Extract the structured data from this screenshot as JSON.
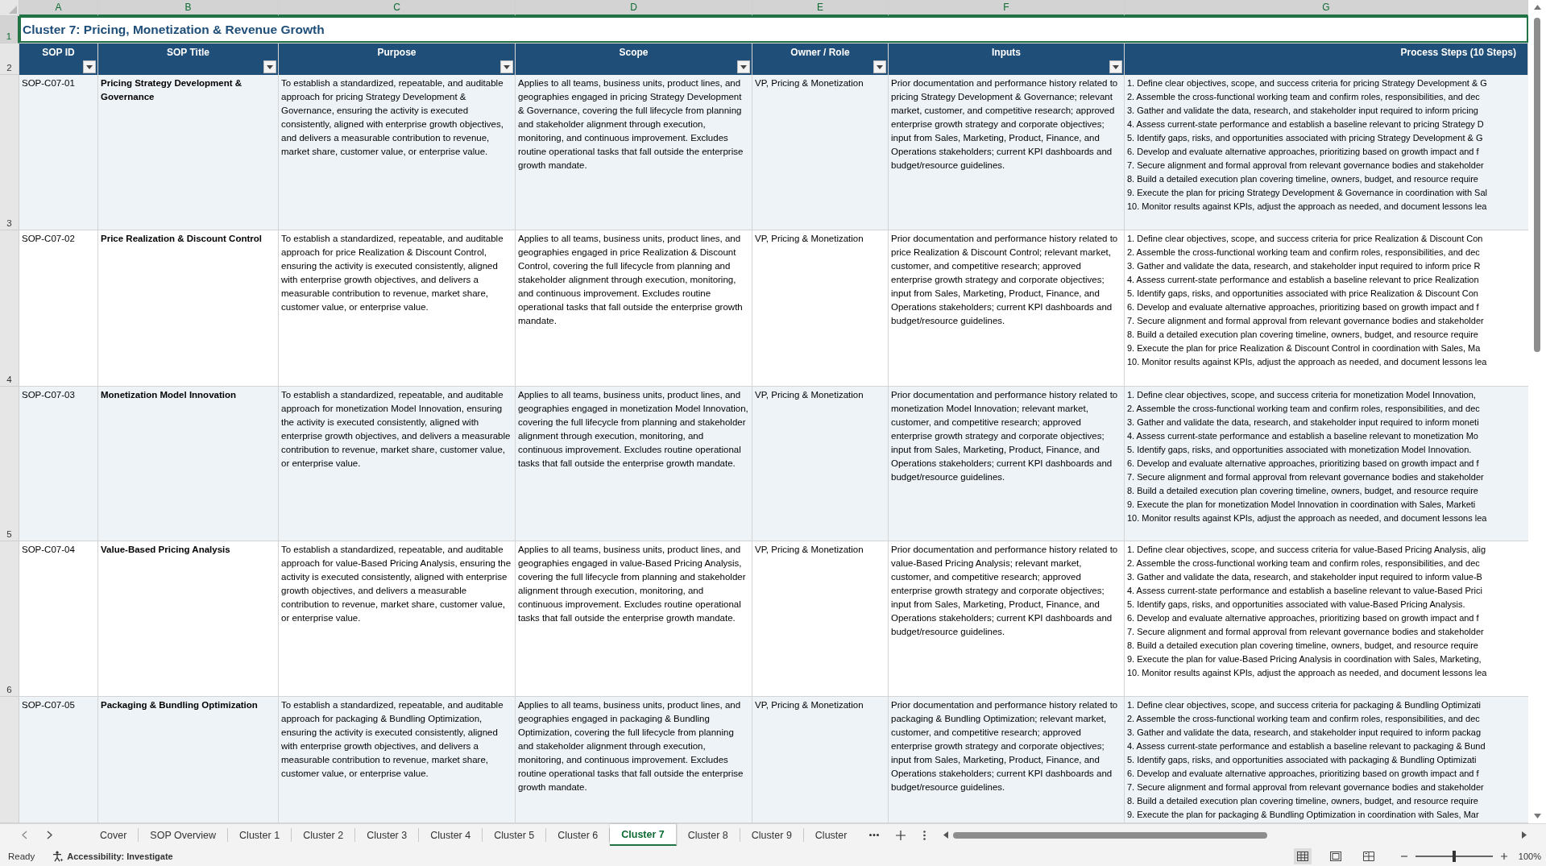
{
  "sheet": {
    "column_letters": [
      "A",
      "B",
      "C",
      "D",
      "E",
      "F",
      "G"
    ],
    "title": {
      "row_number": "1",
      "text": "Cluster 7: Pricing, Monetization & Revenue Growth",
      "selected": true
    },
    "header": {
      "row_number": "2",
      "columns": [
        {
          "label": "SOP ID",
          "filter": true
        },
        {
          "label": "SOP Title",
          "filter": true
        },
        {
          "label": "Purpose",
          "filter": true
        },
        {
          "label": "Scope",
          "filter": true
        },
        {
          "label": "Owner / Role",
          "filter": true
        },
        {
          "label": "Inputs",
          "filter": true
        },
        {
          "label": "Process Steps (10 Steps)",
          "filter": false
        }
      ]
    },
    "rows": [
      {
        "row_number": "3",
        "sop_id": "SOP-C07-01",
        "sop_title": "Pricing Strategy Development & Governance",
        "purpose": "To establish a standardized, repeatable, and auditable approach for pricing Strategy Development & Governance, ensuring the activity is executed consistently, aligned with enterprise growth objectives, and delivers a measurable contribution to revenue, market share, customer value, or enterprise value.",
        "scope": "Applies to all teams, business units, product lines, and geographies engaged in pricing Strategy Development & Governance, covering the full lifecycle from planning and stakeholder alignment through execution, monitoring, and continuous improvement. Excludes routine operational tasks that fall outside the enterprise growth mandate.",
        "owner_role": "VP, Pricing & Monetization",
        "inputs": "Prior documentation and performance history related to pricing Strategy Development & Governance; relevant market, customer, and competitive research; approved enterprise growth strategy and corporate objectives; input from Sales, Marketing, Product, Finance, and Operations stakeholders; current KPI dashboards and budget/resource guidelines.",
        "process_steps": [
          "1. Define clear objectives, scope, and success criteria for pricing Strategy Development & G",
          "2. Assemble the cross-functional working team and confirm roles, responsibilities, and dec",
          "3. Gather and validate the data, research, and stakeholder input required to inform pricing",
          "4. Assess current-state performance and establish a baseline relevant to pricing Strategy D",
          "5. Identify gaps, risks, and opportunities associated with pricing Strategy Development & G",
          "6. Develop and evaluate alternative approaches, prioritizing based on growth impact and f",
          "7. Secure alignment and formal approval from relevant governance bodies and stakeholder",
          "8. Build a detailed execution plan covering timeline, owners, budget, and resource require",
          "9. Execute the plan for pricing Strategy Development & Governance in coordination with Sal",
          "10. Monitor results against KPIs, adjust the approach as needed, and document lessons lea"
        ]
      },
      {
        "row_number": "4",
        "sop_id": "SOP-C07-02",
        "sop_title": "Price Realization & Discount Control",
        "purpose": "To establish a standardized, repeatable, and auditable approach for price Realization & Discount Control, ensuring the activity is executed consistently, aligned with enterprise growth objectives, and delivers a measurable contribution to revenue, market share, customer value, or enterprise value.",
        "scope": "Applies to all teams, business units, product lines, and geographies engaged in price Realization & Discount Control, covering the full lifecycle from planning and stakeholder alignment through execution, monitoring, and continuous improvement. Excludes routine operational tasks that fall outside the enterprise growth mandate.",
        "owner_role": "VP, Pricing & Monetization",
        "inputs": "Prior documentation and performance history related to price Realization & Discount Control; relevant market, customer, and competitive research; approved enterprise growth strategy and corporate objectives; input from Sales, Marketing, Product, Finance, and Operations stakeholders; current KPI dashboards and budget/resource guidelines.",
        "process_steps": [
          "1. Define clear objectives, scope, and success criteria for price Realization & Discount Con",
          "2. Assemble the cross-functional working team and confirm roles, responsibilities, and dec",
          "3. Gather and validate the data, research, and stakeholder input required to inform price R",
          "4. Assess current-state performance and establish a baseline relevant to price Realization",
          "5. Identify gaps, risks, and opportunities associated with price Realization & Discount Con",
          "6. Develop and evaluate alternative approaches, prioritizing based on growth impact and f",
          "7. Secure alignment and formal approval from relevant governance bodies and stakeholder",
          "8. Build a detailed execution plan covering timeline, owners, budget, and resource require",
          "9. Execute the plan for price Realization & Discount Control in coordination with Sales, Ma",
          "10. Monitor results against KPIs, adjust the approach as needed, and document lessons lea"
        ]
      },
      {
        "row_number": "5",
        "sop_id": "SOP-C07-03",
        "sop_title": "Monetization Model Innovation",
        "purpose": "To establish a standardized, repeatable, and auditable approach for monetization Model Innovation, ensuring the activity is executed consistently, aligned with enterprise growth objectives, and delivers a measurable contribution to revenue, market share, customer value, or enterprise value.",
        "scope": "Applies to all teams, business units, product lines, and geographies engaged in monetization Model Innovation, covering the full lifecycle from planning and stakeholder alignment through execution, monitoring, and continuous improvement. Excludes routine operational tasks that fall outside the enterprise growth mandate.",
        "owner_role": "VP, Pricing & Monetization",
        "inputs": "Prior documentation and performance history related to monetization Model Innovation; relevant market, customer, and competitive research; approved enterprise growth strategy and corporate objectives; input from Sales, Marketing, Product, Finance, and Operations stakeholders; current KPI dashboards and budget/resource guidelines.",
        "process_steps": [
          "1. Define clear objectives, scope, and success criteria for monetization Model Innovation,",
          "2. Assemble the cross-functional working team and confirm roles, responsibilities, and dec",
          "3. Gather and validate the data, research, and stakeholder input required to inform moneti",
          "4. Assess current-state performance and establish a baseline relevant to monetization Mo",
          "5. Identify gaps, risks, and opportunities associated with monetization Model Innovation.",
          "6. Develop and evaluate alternative approaches, prioritizing based on growth impact and f",
          "7. Secure alignment and formal approval from relevant governance bodies and stakeholder",
          "8. Build a detailed execution plan covering timeline, owners, budget, and resource require",
          "9. Execute the plan for monetization Model Innovation in coordination with Sales, Marketi",
          "10. Monitor results against KPIs, adjust the approach as needed, and document lessons lea"
        ]
      },
      {
        "row_number": "6",
        "sop_id": "SOP-C07-04",
        "sop_title": "Value-Based Pricing Analysis",
        "purpose": "To establish a standardized, repeatable, and auditable approach for value-Based Pricing Analysis, ensuring the activity is executed consistently, aligned with enterprise growth objectives, and delivers a measurable contribution to revenue, market share, customer value, or enterprise value.",
        "scope": "Applies to all teams, business units, product lines, and geographies engaged in value-Based Pricing Analysis, covering the full lifecycle from planning and stakeholder alignment through execution, monitoring, and continuous improvement. Excludes routine operational tasks that fall outside the enterprise growth mandate.",
        "owner_role": "VP, Pricing & Monetization",
        "inputs": "Prior documentation and performance history related to value-Based Pricing Analysis; relevant market, customer, and competitive research; approved enterprise growth strategy and corporate objectives; input from Sales, Marketing, Product, Finance, and Operations stakeholders; current KPI dashboards and budget/resource guidelines.",
        "process_steps": [
          "1. Define clear objectives, scope, and success criteria for value-Based Pricing Analysis, alig",
          "2. Assemble the cross-functional working team and confirm roles, responsibilities, and dec",
          "3. Gather and validate the data, research, and stakeholder input required to inform value-B",
          "4. Assess current-state performance and establish a baseline relevant to value-Based Prici",
          "5. Identify gaps, risks, and opportunities associated with value-Based Pricing Analysis.",
          "6. Develop and evaluate alternative approaches, prioritizing based on growth impact and f",
          "7. Secure alignment and formal approval from relevant governance bodies and stakeholder",
          "8. Build a detailed execution plan covering timeline, owners, budget, and resource require",
          "9. Execute the plan for value-Based Pricing Analysis in coordination with Sales, Marketing,",
          "10. Monitor results against KPIs, adjust the approach as needed, and document lessons lea"
        ]
      },
      {
        "sop_id": "SOP-C07-05",
        "sop_title": "Packaging & Bundling Optimization",
        "purpose": "To establish a standardized, repeatable, and auditable approach for packaging & Bundling Optimization, ensuring the activity is executed consistently, aligned with enterprise growth objectives, and delivers a measurable contribution to revenue, market share, customer value, or enterprise value.",
        "scope": "Applies to all teams, business units, product lines, and geographies engaged in packaging & Bundling Optimization, covering the full lifecycle from planning and stakeholder alignment through execution, monitoring, and continuous improvement. Excludes routine operational tasks that fall outside the enterprise growth mandate.",
        "owner_role": "VP, Pricing & Monetization",
        "inputs": "Prior documentation and performance history related to packaging & Bundling Optimization; relevant market, customer, and competitive research; approved enterprise growth strategy and corporate objectives; input from Sales, Marketing, Product, Finance, and Operations stakeholders; current KPI dashboards and budget/resource guidelines.",
        "process_steps": [
          "1. Define clear objectives, scope, and success criteria for packaging & Bundling Optimizati",
          "2. Assemble the cross-functional working team and confirm roles, responsibilities, and dec",
          "3. Gather and validate the data, research, and stakeholder input required to inform packag",
          "4. Assess current-state performance and establish a baseline relevant to packaging & Bund",
          "5. Identify gaps, risks, and opportunities associated with packaging & Bundling Optimizati",
          "6. Develop and evaluate alternative approaches, prioritizing based on growth impact and f",
          "7. Secure alignment and formal approval from relevant governance bodies and stakeholder",
          "8. Build a detailed execution plan covering timeline, owners, budget, and resource require",
          "9. Execute the plan for packaging & Bundling Optimization in coordination with Sales, Mar"
        ]
      }
    ]
  },
  "sheet_tabs": [
    {
      "label": "Cover",
      "selected": false
    },
    {
      "label": "SOP Overview",
      "selected": false
    },
    {
      "label": "Cluster 1",
      "selected": false
    },
    {
      "label": "Cluster 2",
      "selected": false
    },
    {
      "label": "Cluster 3",
      "selected": false
    },
    {
      "label": "Cluster 4",
      "selected": false
    },
    {
      "label": "Cluster 5",
      "selected": false
    },
    {
      "label": "Cluster 6",
      "selected": false
    },
    {
      "label": "Cluster 7",
      "selected": true
    },
    {
      "label": "Cluster 8",
      "selected": false
    },
    {
      "label": "Cluster 9",
      "selected": false
    },
    {
      "label": "Cluster",
      "selected": false
    }
  ],
  "status_bar": {
    "status": "Ready",
    "accessibility": "Accessibility: Investigate",
    "zoom_slider": {
      "level": 0.5
    },
    "zoom": "100%"
  }
}
